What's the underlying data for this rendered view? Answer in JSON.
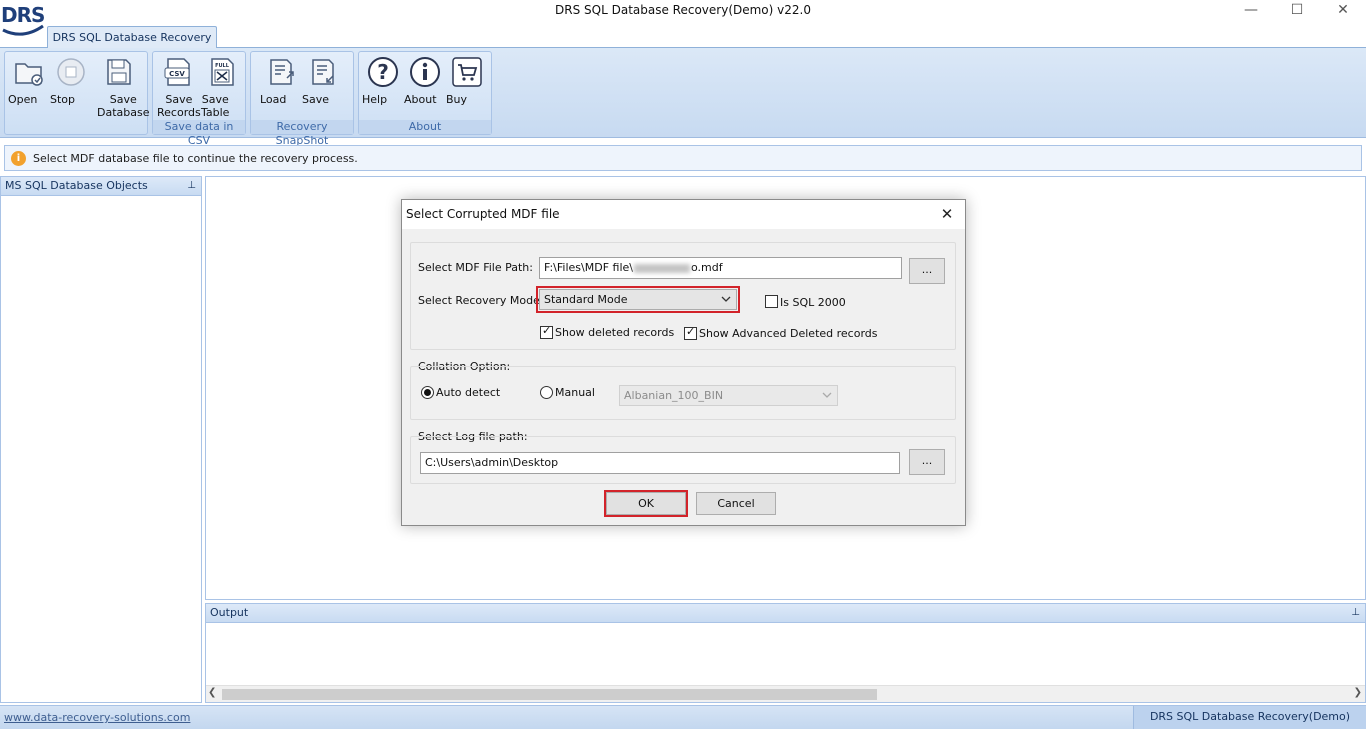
{
  "window": {
    "title": "DRS SQL Database Recovery(Demo) v22.0",
    "logo": "DRS",
    "min_icon": "minimize-icon",
    "max_icon": "maximize-icon",
    "close_icon": "close-icon"
  },
  "ribbon": {
    "tab": "DRS SQL Database Recovery",
    "groups": {
      "file": {
        "buttons": [
          {
            "label": "Open",
            "icon": "open-folder-icon"
          },
          {
            "label": "Stop",
            "icon": "stop-icon"
          },
          {
            "label": "Save\nDatabase",
            "icon": "save-database-icon"
          }
        ]
      },
      "csv": {
        "label": "Save data in CSV",
        "buttons": [
          {
            "label": "Save\nRecords",
            "icon": "csv-icon",
            "badge": "CSV"
          },
          {
            "label": "Save\nTable",
            "icon": "excel-table-icon",
            "badge": "FULL"
          }
        ]
      },
      "snapshot": {
        "label": "Recovery SnapShot",
        "buttons": [
          {
            "label": "Load",
            "icon": "load-snapshot-icon"
          },
          {
            "label": "Save",
            "icon": "save-snapshot-icon"
          }
        ]
      },
      "about": {
        "label": "About",
        "buttons": [
          {
            "label": "Help",
            "icon": "help-icon"
          },
          {
            "label": "About",
            "icon": "info-icon"
          },
          {
            "label": "Buy",
            "icon": "cart-icon"
          }
        ]
      }
    }
  },
  "infobar": {
    "icon": "info-icon",
    "icon_glyph": "i",
    "text": "Select MDF database file to continue the recovery process."
  },
  "left_pane": {
    "title": "MS SQL Database Objects",
    "pin_glyph": "⊥"
  },
  "output_pane": {
    "title": "Output",
    "pin_glyph": "⊥"
  },
  "statusbar": {
    "link": "www.data-recovery-solutions.com",
    "right_text": "DRS SQL Database Recovery(Demo) v22.0"
  },
  "dialog": {
    "title": "Select Corrupted MDF file",
    "close_glyph": "✕",
    "mdf_path_label": "Select MDF File Path:",
    "mdf_path_prefix": "F:\\Files\\MDF file\\",
    "mdf_path_suffix": "o.mdf",
    "browse_label": "...",
    "recovery_mode_label": "Select Recovery Mode:",
    "recovery_mode_value": "Standard Mode",
    "is_sql2000_label": "Is SQL 2000",
    "is_sql2000_checked": false,
    "show_deleted_label": "Show deleted records",
    "show_deleted_checked": true,
    "show_advanced_label": "Show Advanced Deleted records",
    "show_advanced_checked": true,
    "check_glyph": "✓",
    "collation_label": "Collation Option:",
    "auto_detect_label": "Auto detect",
    "auto_detect_selected": true,
    "manual_label": "Manual",
    "collation_value": "Albanian_100_BIN",
    "log_path_label": "Select Log file path:",
    "log_path_value": "C:\\Users\\admin\\Desktop",
    "ok_label": "OK",
    "cancel_label": "Cancel",
    "highlight_color": "#d2232a"
  }
}
